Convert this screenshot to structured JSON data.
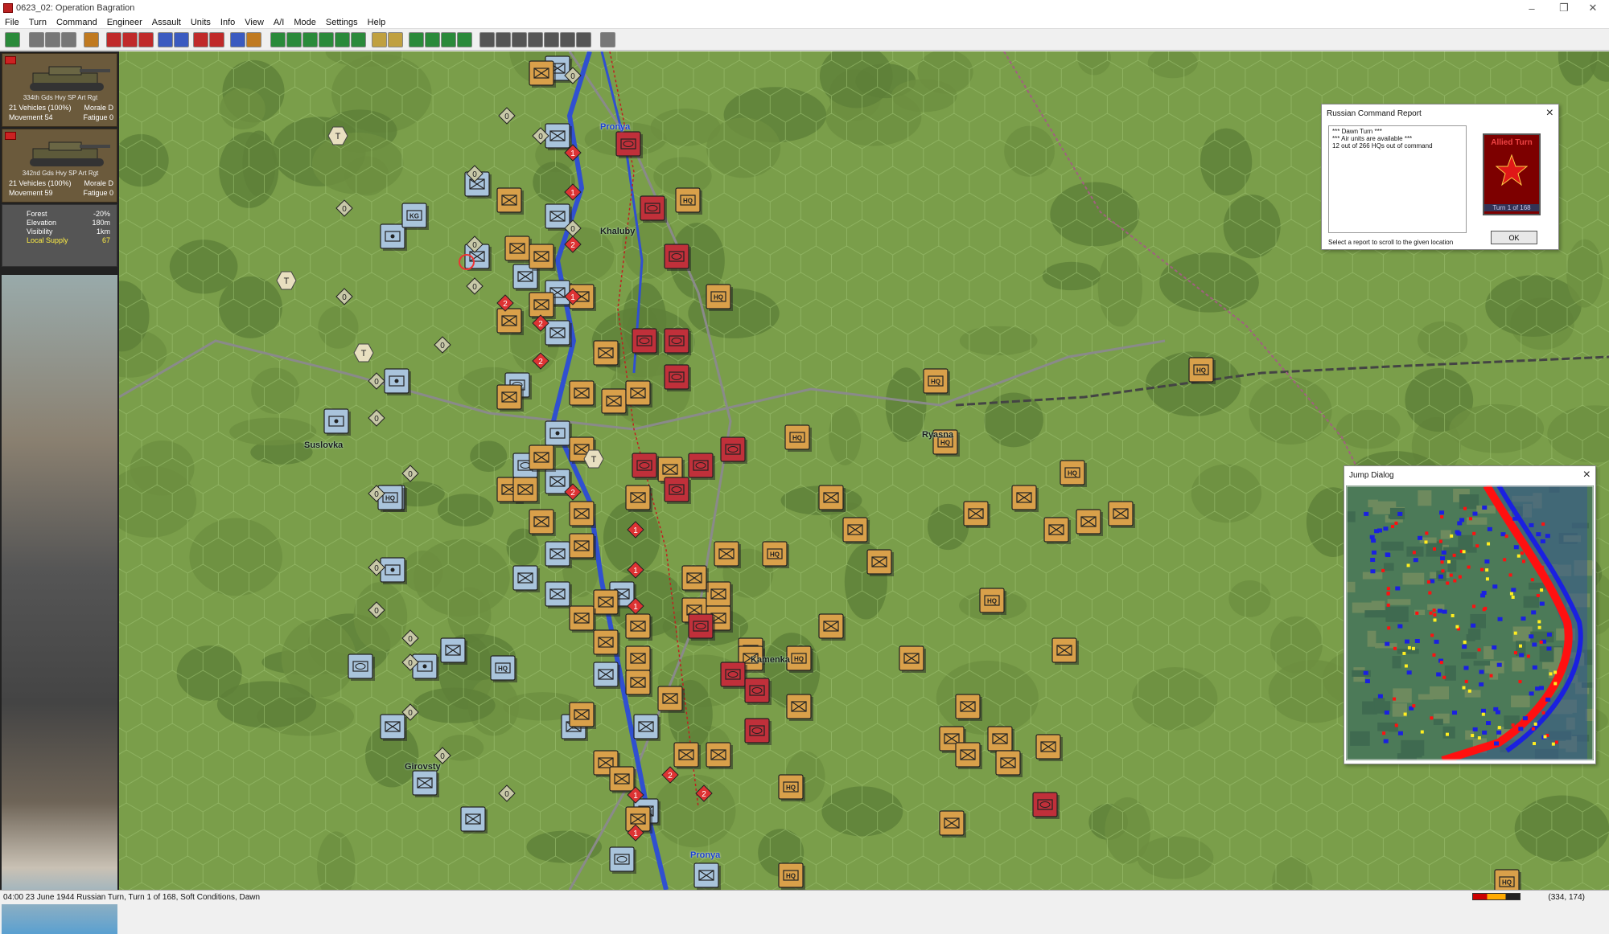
{
  "window": {
    "title": "0623_02: Operation Bagration"
  },
  "menu": [
    "File",
    "Turn",
    "Command",
    "Engineer",
    "Assault",
    "Units",
    "Info",
    "View",
    "A/I",
    "Mode",
    "Settings",
    "Help"
  ],
  "units": [
    {
      "name": "334th Gds Hvy SP Art Rgt",
      "strength": "21 Vehicles (100%)",
      "morale": "Morale D",
      "movement": "Movement 54",
      "fatigue": "Fatigue 0"
    },
    {
      "name": "342nd Gds Hvy SP Art Rgt",
      "strength": "21 Vehicles (100%)",
      "morale": "Morale D",
      "movement": "Movement 59",
      "fatigue": "Fatigue 0"
    }
  ],
  "terrain": [
    {
      "label": "Forest",
      "value": "-20%"
    },
    {
      "label": "Elevation",
      "value": "180m"
    },
    {
      "label": "Visibility",
      "value": "1km"
    },
    {
      "label": "Local Supply",
      "value": "67"
    }
  ],
  "places": [
    {
      "name": "Pronya",
      "style": "blue"
    },
    {
      "name": "Khaluby",
      "style": "dark"
    },
    {
      "name": "Suslovka",
      "style": "dark"
    },
    {
      "name": "Ryasna",
      "style": "dark"
    },
    {
      "name": "Kamenka",
      "style": "dark"
    },
    {
      "name": "Girovsty",
      "style": "dark"
    },
    {
      "name": "Pronya",
      "style": "blue"
    }
  ],
  "report_dialog": {
    "title": "Russian Command Report",
    "lines": [
      "*** Dawn Turn ***",
      "*** Air units are available ***",
      "12 out of 266 HQs out of command"
    ],
    "footer": "Select a report to scroll to the given location",
    "ok": "OK",
    "badge_title": "Allied Turn",
    "badge_turn": "Turn 1 of 168"
  },
  "jump_dialog": {
    "title": "Jump Dialog"
  },
  "status": {
    "text": "04:00 23 June 1944 Russian Turn, Turn 1 of 168, Soft Conditions, Dawn",
    "coord": "(334, 174)"
  },
  "counter_labels": {
    "hq": "HQ",
    "kg": "KG",
    "t": "T"
  },
  "colors": {
    "soviet": "#d9a04a",
    "guards": "#c0303a",
    "german": "#a9c4dc",
    "river": "#3050d0",
    "terrain": "#7a9e4a"
  }
}
